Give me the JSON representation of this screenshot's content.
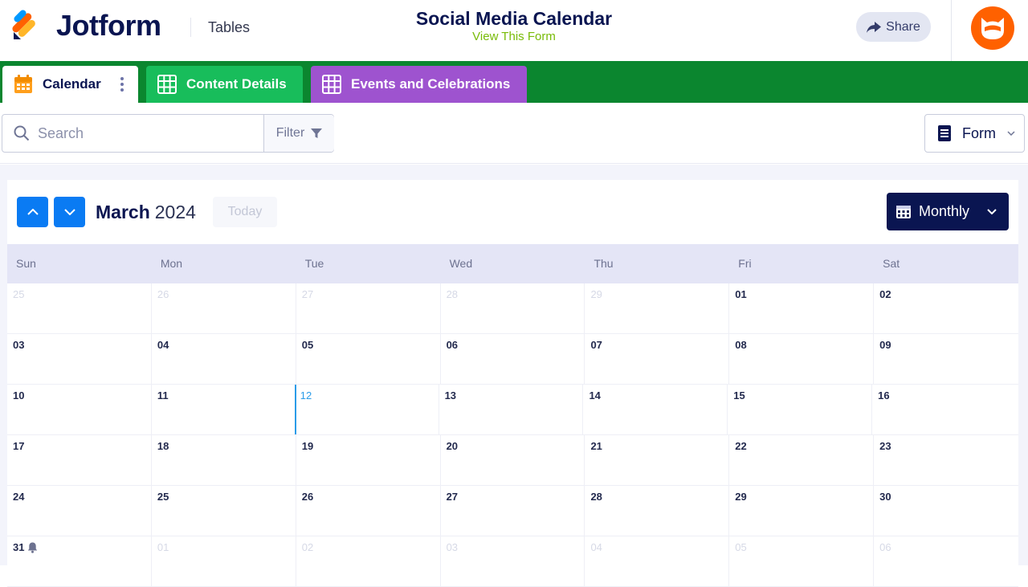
{
  "header": {
    "brand": "Jotform",
    "product": "Tables",
    "title": "Social Media Calendar",
    "view_form_link": "View This Form",
    "share_label": "Share"
  },
  "tabs": [
    {
      "label": "Calendar",
      "icon": "calendar-icon",
      "active": true
    },
    {
      "label": "Content Details",
      "icon": "grid-table-icon",
      "active": false
    },
    {
      "label": "Events and Celebrations",
      "icon": "grid-table-icon",
      "active": false
    }
  ],
  "toolbar": {
    "search_placeholder": "Search",
    "filter_label": "Filter",
    "form_label": "Form"
  },
  "calendar": {
    "month": "March",
    "year": "2024",
    "today_label": "Today",
    "view_label": "Monthly",
    "weekdays": [
      "Sun",
      "Mon",
      "Tue",
      "Wed",
      "Thu",
      "Fri",
      "Sat"
    ],
    "weeks": [
      [
        {
          "d": "25",
          "muted": true
        },
        {
          "d": "26",
          "muted": true
        },
        {
          "d": "27",
          "muted": true
        },
        {
          "d": "28",
          "muted": true
        },
        {
          "d": "29",
          "muted": true
        },
        {
          "d": "01"
        },
        {
          "d": "02"
        }
      ],
      [
        {
          "d": "03"
        },
        {
          "d": "04"
        },
        {
          "d": "05"
        },
        {
          "d": "06"
        },
        {
          "d": "07"
        },
        {
          "d": "08"
        },
        {
          "d": "09"
        }
      ],
      [
        {
          "d": "10"
        },
        {
          "d": "11"
        },
        {
          "d": "12",
          "today": true
        },
        {
          "d": "13"
        },
        {
          "d": "14"
        },
        {
          "d": "15"
        },
        {
          "d": "16"
        }
      ],
      [
        {
          "d": "17"
        },
        {
          "d": "18"
        },
        {
          "d": "19"
        },
        {
          "d": "20"
        },
        {
          "d": "21"
        },
        {
          "d": "22"
        },
        {
          "d": "23"
        }
      ],
      [
        {
          "d": "24"
        },
        {
          "d": "25"
        },
        {
          "d": "26"
        },
        {
          "d": "27"
        },
        {
          "d": "28"
        },
        {
          "d": "29"
        },
        {
          "d": "30"
        }
      ],
      [
        {
          "d": "31",
          "icon": "bell-icon"
        },
        {
          "d": "01",
          "muted": true
        },
        {
          "d": "02",
          "muted": true
        },
        {
          "d": "03",
          "muted": true
        },
        {
          "d": "04",
          "muted": true
        },
        {
          "d": "05",
          "muted": true
        },
        {
          "d": "06",
          "muted": true
        }
      ]
    ]
  },
  "colors": {
    "brand_navy": "#0a1551",
    "tab_bar_green": "#0b862f",
    "tab_content_green": "#18bd5b",
    "tab_events_purple": "#9e53cf",
    "nav_blue": "#0a7bf3",
    "avatar_orange": "#ff6100",
    "link_green": "#78bb07"
  }
}
